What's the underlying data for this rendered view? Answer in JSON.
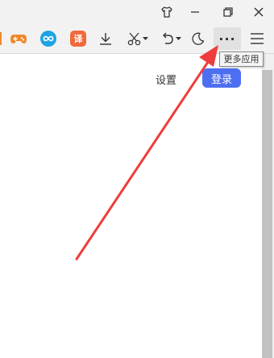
{
  "tooltip": {
    "text": "更多应用"
  },
  "toolbar": {
    "translate_label": "译",
    "more_apps_label": "···"
  },
  "page": {
    "settings_label": "设置",
    "login_label": "登录"
  },
  "colors": {
    "login_bg": "#4e6ef2",
    "annotation_arrow": "#ef3c3c",
    "game_icon": "#f0882c",
    "infinity_icon": "#1ca3e3",
    "translate_icon": "#f06a3b"
  },
  "icons": [
    "shirt-icon",
    "restore-icon",
    "close-icon",
    "gamepad-icon",
    "infinity-icon",
    "translate-icon",
    "download-icon",
    "scissors-icon",
    "undo-icon",
    "moon-icon",
    "more-icon",
    "menu-icon"
  ]
}
